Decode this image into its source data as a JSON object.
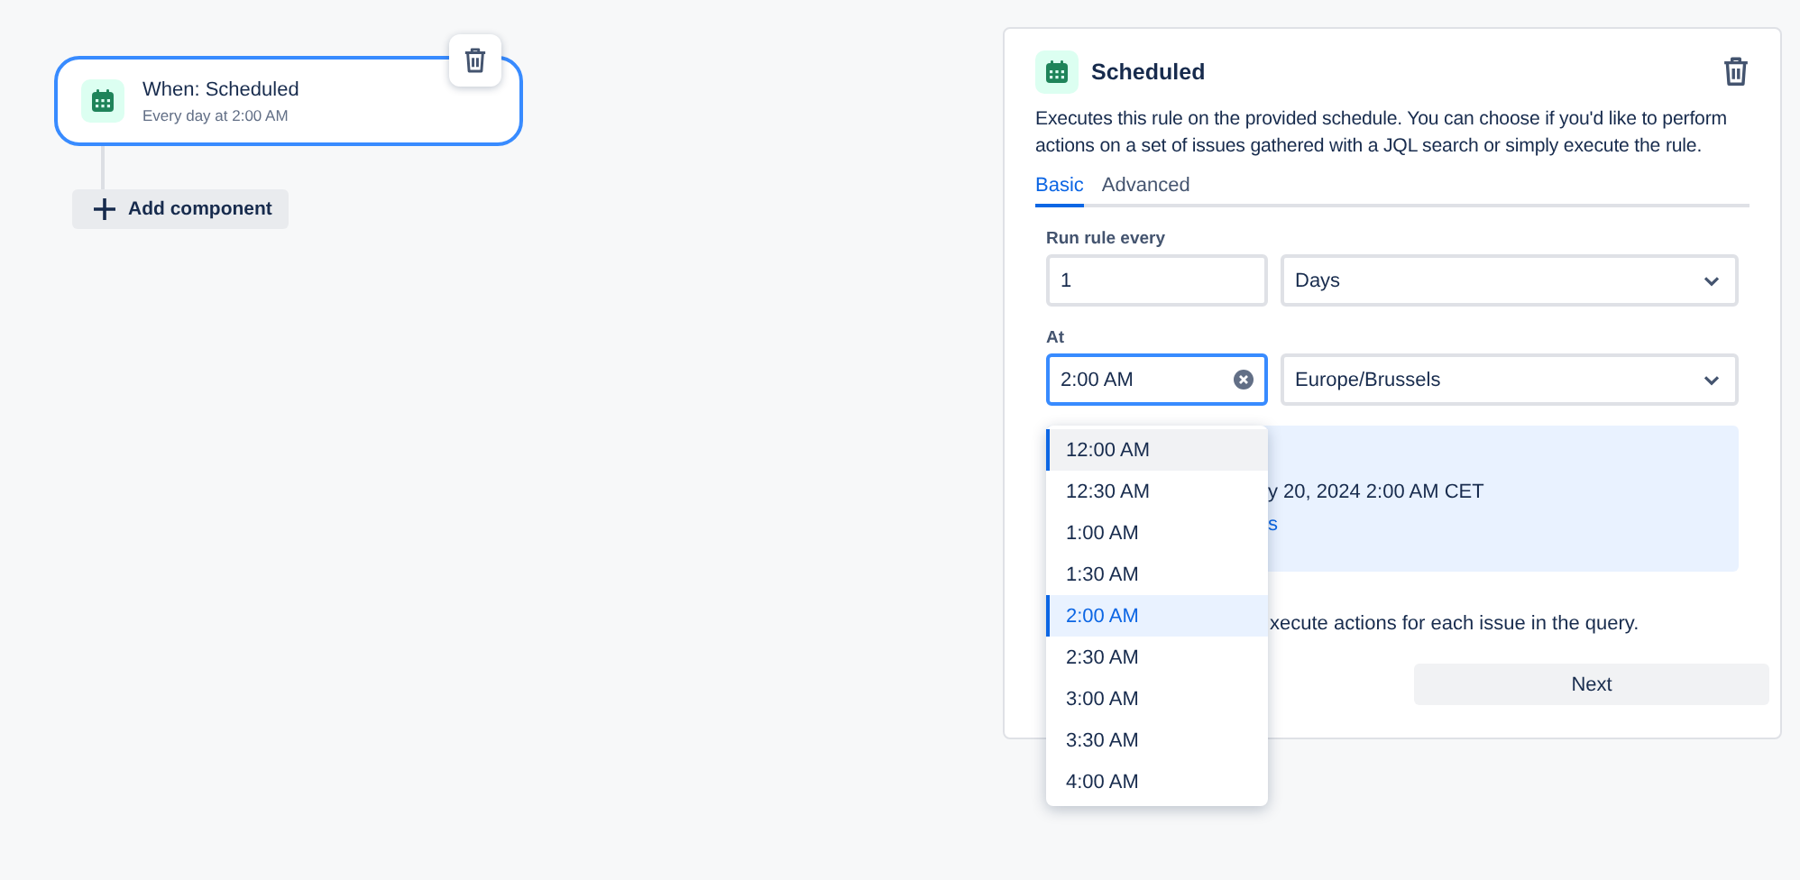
{
  "canvas": {
    "trigger": {
      "title": "When: Scheduled",
      "subtitle": "Every day at 2:00 AM",
      "selected": true
    },
    "add_button": {
      "label": "Add component"
    }
  },
  "panel": {
    "title": "Scheduled",
    "description": "Executes this rule on the provided schedule. You can choose if you'd like to perform actions on a set of issues gathered with a JQL search or simply execute the rule.",
    "tabs": [
      {
        "label": "Basic",
        "selected": true
      },
      {
        "label": "Advanced",
        "selected": false
      }
    ],
    "run_every": {
      "label": "Run rule every",
      "value": "1",
      "unit": "Days"
    },
    "at": {
      "label": "At",
      "value": "2:00 AM",
      "focused": true,
      "timezone": "Europe/Brussels"
    },
    "info": {
      "next_run_partial": "y 20, 2024 2:00 AM CET",
      "link_partial": "s"
    },
    "checkbox_label_partial": "xecute actions for each issue in the query.",
    "next_button": "Next",
    "time_menu": [
      {
        "label": "12:00 AM",
        "selected": false,
        "focused": true
      },
      {
        "label": "12:30 AM",
        "selected": false,
        "focused": false
      },
      {
        "label": "1:00 AM",
        "selected": false,
        "focused": false
      },
      {
        "label": "1:30 AM",
        "selected": false,
        "focused": false
      },
      {
        "label": "2:00 AM",
        "selected": true,
        "focused": false
      },
      {
        "label": "2:30 AM",
        "selected": false,
        "focused": false
      },
      {
        "label": "3:00 AM",
        "selected": false,
        "focused": false
      },
      {
        "label": "3:30 AM",
        "selected": false,
        "focused": false
      },
      {
        "label": "4:00 AM",
        "selected": false,
        "focused": false
      }
    ]
  }
}
